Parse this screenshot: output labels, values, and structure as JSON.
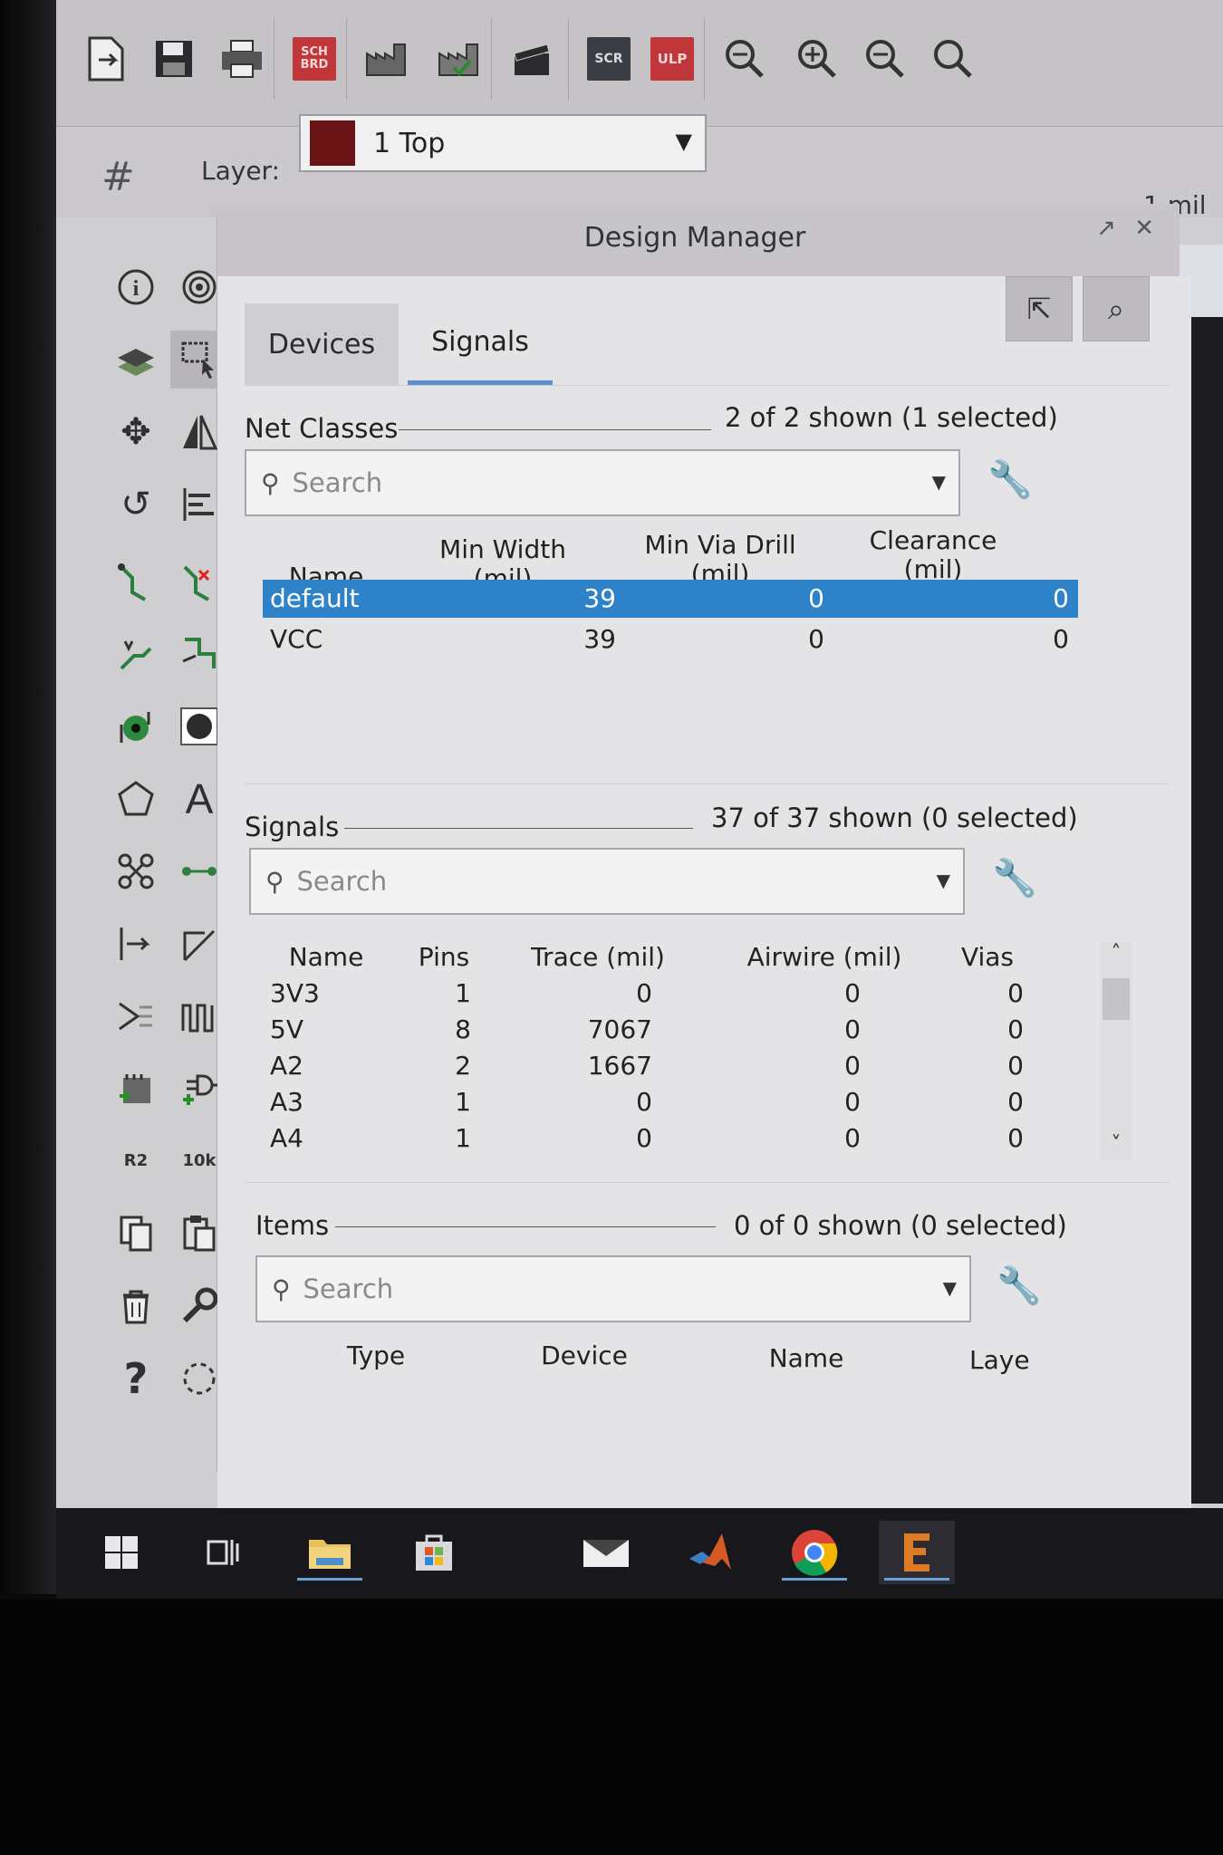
{
  "toolbar": {
    "buttons": [
      {
        "icon": "open-file-icon"
      },
      {
        "icon": "save-icon"
      },
      {
        "icon": "print-icon"
      },
      {
        "icon": "sch-brd-switch-icon",
        "label": "SCH BRD"
      },
      {
        "icon": "cam-processor-icon"
      },
      {
        "icon": "manufacturing-icon"
      },
      {
        "icon": "script-icon"
      },
      {
        "icon": "run-script-icon",
        "label": "SCR"
      },
      {
        "icon": "run-ulp-icon",
        "label": "ULP"
      },
      {
        "icon": "zoom-fit-icon"
      },
      {
        "icon": "zoom-in-icon"
      },
      {
        "icon": "zoom-out-icon"
      },
      {
        "icon": "zoom-select-icon"
      }
    ]
  },
  "layer": {
    "label": "Layer:",
    "value": "1 Top",
    "swatch_color": "#6b1418"
  },
  "grid_readout": "1 mil (",
  "design_manager": {
    "title": "Design Manager",
    "tabs": [
      {
        "label": "Devices",
        "active": false
      },
      {
        "label": "Signals",
        "active": true
      }
    ],
    "net_classes": {
      "title": "Net Classes",
      "count": "2 of 2 shown (1 selected)",
      "search_placeholder": "Search",
      "columns": [
        "Name",
        "Min Width\n(mil)",
        "Min Via Drill\n(mil)",
        "Clearance\n(mil)"
      ],
      "rows": [
        {
          "name": "default",
          "min_width": "39",
          "min_via_drill": "0",
          "clearance": "0",
          "selected": true
        },
        {
          "name": "VCC",
          "min_width": "39",
          "min_via_drill": "0",
          "clearance": "0",
          "selected": false
        }
      ]
    },
    "signals": {
      "title": "Signals",
      "count": "37 of 37 shown (0 selected)",
      "search_placeholder": "Search",
      "columns": [
        "Name",
        "Pins",
        "Trace (mil)",
        "Airwire (mil)",
        "Vias"
      ],
      "rows": [
        {
          "name": "3V3",
          "pins": "1",
          "trace": "0",
          "airwire": "0",
          "vias": "0"
        },
        {
          "name": "5V",
          "pins": "8",
          "trace": "7067",
          "airwire": "0",
          "vias": "0"
        },
        {
          "name": "A2",
          "pins": "2",
          "trace": "1667",
          "airwire": "0",
          "vias": "0"
        },
        {
          "name": "A3",
          "pins": "1",
          "trace": "0",
          "airwire": "0",
          "vias": "0"
        },
        {
          "name": "A4",
          "pins": "1",
          "trace": "0",
          "airwire": "0",
          "vias": "0"
        }
      ]
    },
    "items": {
      "title": "Items",
      "count": "0 of 0 shown (0 selected)",
      "search_placeholder": "Search",
      "columns": [
        "Type",
        "Device",
        "Name",
        "Laye"
      ]
    }
  },
  "palette": {
    "tools": [
      "info-icon",
      "show-icon",
      "layer-settings-icon",
      "select-group-icon",
      "move-icon",
      "mirror-icon",
      "rotate-icon",
      "align-icon",
      "route-icon",
      "ripup-icon",
      "autoroute-icon",
      "slice-icon",
      "via-icon",
      "hole-icon",
      "polygon-icon",
      "text-icon",
      "split-icon",
      "wire-icon",
      "miter-icon",
      "line-icon",
      "meander-icon",
      "optimize-icon",
      "add-part-icon",
      "add-pin-icon",
      "name-icon",
      "value-icon",
      "copy-icon",
      "paste-icon",
      "delete-icon",
      "change-icon",
      "help-icon",
      "group-icon"
    ],
    "name_label": "R2",
    "value_label": "10k"
  },
  "taskbar": {
    "apps": [
      "windows-start-icon",
      "task-view-icon",
      "file-explorer-icon",
      "store-icon",
      "mail-icon",
      "matlab-icon",
      "chrome-icon",
      "eagle-icon"
    ]
  }
}
